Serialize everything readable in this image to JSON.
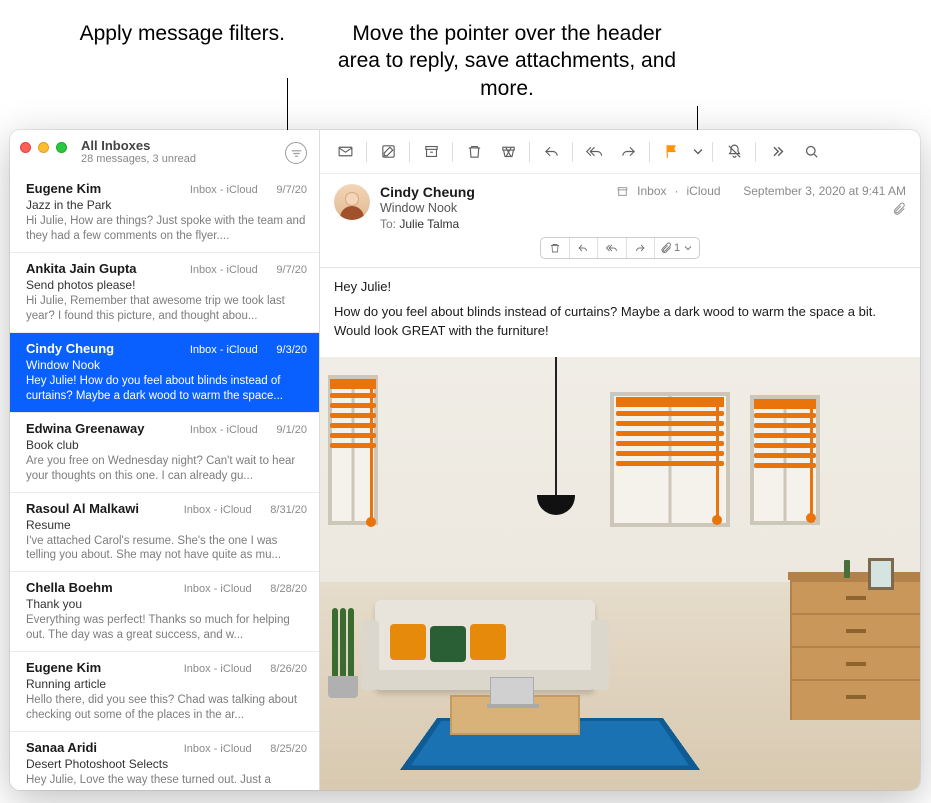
{
  "callouts": {
    "left": "Apply message filters.",
    "right": "Move the pointer over the header area to reply, save attachments, and more."
  },
  "mailbox": {
    "title": "All Inboxes",
    "subtitle": "28 messages, 3 unread"
  },
  "messages": [
    {
      "sender": "Eugene Kim",
      "mbox": "Inbox - iCloud",
      "date": "9/7/20",
      "subject": "Jazz in the Park",
      "preview": "Hi Julie, How are things? Just spoke with the team and they had a few comments on the flyer....",
      "selected": false,
      "unread": false
    },
    {
      "sender": "Ankita Jain Gupta",
      "mbox": "Inbox - iCloud",
      "date": "9/7/20",
      "subject": "Send photos please!",
      "preview": "Hi Julie, Remember that awesome trip we took last year? I found this picture, and thought abou...",
      "selected": false,
      "unread": false
    },
    {
      "sender": "Cindy Cheung",
      "mbox": "Inbox - iCloud",
      "date": "9/3/20",
      "subject": "Window Nook",
      "preview": "Hey Julie! How do you feel about blinds instead of curtains? Maybe a dark wood to warm the space...",
      "selected": true,
      "unread": false
    },
    {
      "sender": "Edwina Greenaway",
      "mbox": "Inbox - iCloud",
      "date": "9/1/20",
      "subject": "Book club",
      "preview": "Are you free on Wednesday night? Can't wait to hear your thoughts on this one. I can already gu...",
      "selected": false,
      "unread": false
    },
    {
      "sender": "Rasoul Al Malkawi",
      "mbox": "Inbox - iCloud",
      "date": "8/31/20",
      "subject": "Resume",
      "preview": "I've attached Carol's resume. She's the one I was telling you about. She may not have quite as mu...",
      "selected": false,
      "unread": false
    },
    {
      "sender": "Chella Boehm",
      "mbox": "Inbox - iCloud",
      "date": "8/28/20",
      "subject": "Thank you",
      "preview": "Everything was perfect! Thanks so much for helping out. The day was a great success, and w...",
      "selected": false,
      "unread": false
    },
    {
      "sender": "Eugene Kim",
      "mbox": "Inbox - iCloud",
      "date": "8/26/20",
      "subject": "Running article",
      "preview": "Hello there, did you see this? Chad was talking about checking out some of the places in the ar...",
      "selected": false,
      "unread": false
    },
    {
      "sender": "Sanaa Aridi",
      "mbox": "Inbox - iCloud",
      "date": "8/25/20",
      "subject": "Desert Photoshoot Selects",
      "preview": "Hey Julie, Love the way these turned out. Just a",
      "selected": false,
      "unread": false
    }
  ],
  "toolbar": {
    "get_mail": "get-mail",
    "compose": "compose",
    "archive": "archive",
    "delete": "delete",
    "junk": "junk",
    "reply": "reply",
    "reply_all": "reply-all",
    "forward": "forward",
    "flag": "flag",
    "flag_menu": "flag-menu",
    "mute": "mute",
    "more": "more",
    "search": "search"
  },
  "viewer": {
    "sender": "Cindy Cheung",
    "subject": "Window Nook",
    "to_label": "To:",
    "to_name": "Julie Talma",
    "mbox_folder": "Inbox",
    "mbox_account": "iCloud",
    "date": "September 3, 2020 at 9:41 AM",
    "attachment_count": "1",
    "body_line1": "Hey Julie!",
    "body_line2": "How do you feel about blinds instead of curtains? Maybe a dark wood to warm the space a bit. Would look GREAT with the furniture!"
  }
}
